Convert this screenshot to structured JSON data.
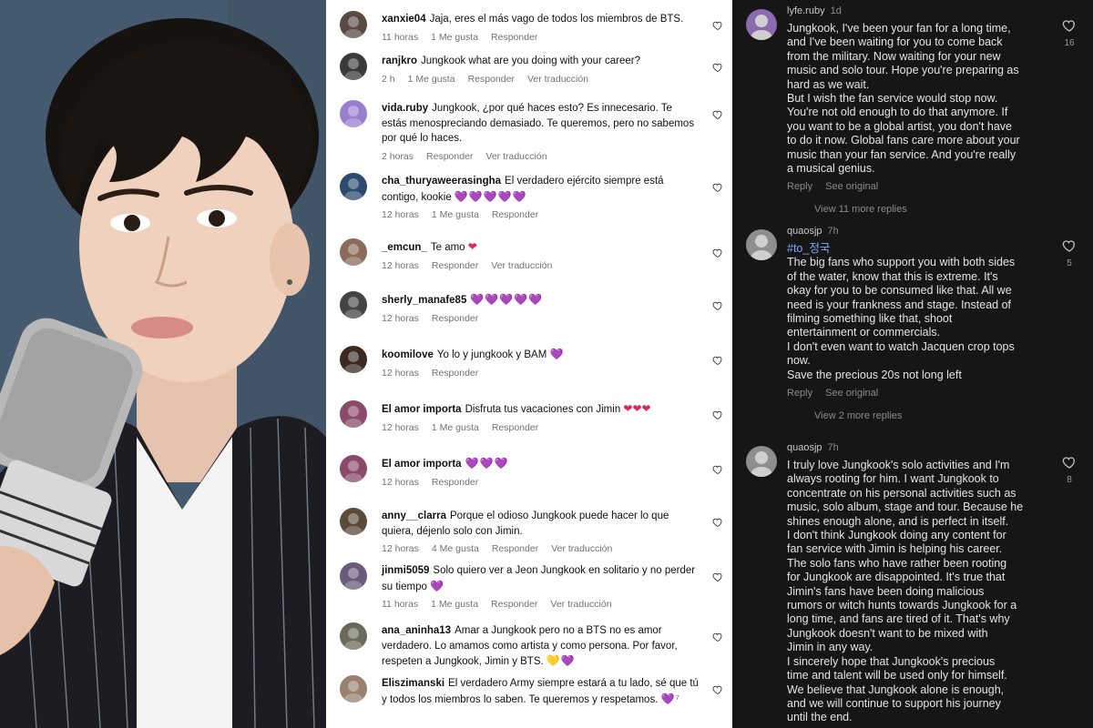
{
  "light_comments": [
    {
      "user": "xanxie04",
      "text": "Jaja, eres el más vago de todos los miembros de BTS.",
      "hearts": "",
      "time": "11 horas",
      "likes": "1 Me gusta",
      "reply": "Responder",
      "translate": "",
      "avatar_color": "#5a4a44"
    },
    {
      "user": "ranjkro",
      "text": "Jungkook what are you doing with your career?",
      "hearts": "",
      "time": "2 h",
      "likes": "1 Me gusta",
      "reply": "Responder",
      "translate": "Ver traducción",
      "avatar_color": "#3a3a3a"
    },
    {
      "user": "vida.ruby",
      "text": "Jungkook, ¿por qué haces esto? Es innecesario. Te estás menospreciando demasiado. Te queremos, pero no sabemos por qué lo haces.",
      "hearts": "",
      "time": "2 horas",
      "likes": "",
      "reply": "Responder",
      "translate": "Ver traducción",
      "avatar_color": "#9a7fd0"
    },
    {
      "user": "cha_thuryaweerasingha",
      "text": "El verdadero ejército siempre está contigo, kookie",
      "hearts": "💜💜💜💜💜",
      "time": "12 horas",
      "likes": "1 Me gusta",
      "reply": "Responder",
      "translate": "",
      "avatar_color": "#2c4a6e"
    },
    {
      "user": "_emcun_",
      "text": "Te amo",
      "hearts": "❤",
      "time": "12 horas",
      "likes": "",
      "reply": "Responder",
      "translate": "Ver traducción",
      "avatar_color": "#8a6a5a"
    },
    {
      "user": "sherly_manafe85",
      "text": "",
      "hearts": "💜💜💜💜💜",
      "time": "12 horas",
      "likes": "",
      "reply": "Responder",
      "translate": "",
      "avatar_color": "#444"
    },
    {
      "user": "koomilove",
      "text": "Yo lo y jungkook y BAM",
      "hearts": "💜",
      "time": "12 horas",
      "likes": "",
      "reply": "Responder",
      "translate": "",
      "avatar_color": "#3b2a22"
    },
    {
      "user": "El amor importa",
      "text": "Disfruta tus vacaciones con Jimin",
      "hearts": "❤❤❤",
      "time": "12 horas",
      "likes": "1 Me gusta",
      "reply": "Responder",
      "translate": "",
      "avatar_color": "#8a4a6a"
    },
    {
      "user": "El amor importa",
      "text": "",
      "hearts": "💜💜💜",
      "time": "12 horas",
      "likes": "",
      "reply": "Responder",
      "translate": "",
      "avatar_color": "#8a4a6a"
    },
    {
      "user": "anny__clarra",
      "text": "Porque el odioso Jungkook puede hacer lo que quiera, déjenlo solo con Jimin.",
      "hearts": "",
      "time": "12 horas",
      "likes": "4 Me gusta",
      "reply": "Responder",
      "translate": "Ver traducción",
      "avatar_color": "#5a4a3a"
    },
    {
      "user": "jinmi5059",
      "text": "Solo quiero ver a Jeon Jungkook en solitario y no perder su tiempo",
      "hearts": "💜",
      "time": "11 horas",
      "likes": "1 Me gusta",
      "reply": "Responder",
      "translate": "Ver traducción",
      "avatar_color": "#6a5a7a"
    },
    {
      "user": "ana_aninha13",
      "text": "Amar a Jungkook pero no a BTS no es amor verdadero. Lo amamos como artista y como persona. Por favor, respeten a Jungkook, Jimin y BTS.",
      "hearts": "💛💜",
      "time": "",
      "likes": "",
      "reply": "",
      "translate": "",
      "avatar_color": "#6a6a5a"
    },
    {
      "user": "Eliszimanski",
      "text": "El verdadero Army siempre estará a tu lado, sé que tú y todos los miembros lo saben. Te queremos y respetamos.",
      "hearts": "💜⁷",
      "time": "",
      "likes": "",
      "reply": "",
      "translate": "",
      "avatar_color": "#9a8070"
    }
  ],
  "dark_comments": [
    {
      "user": "lyfe.ruby",
      "time": "1d",
      "tag": "",
      "lines": [
        "Jungkook, I've been your fan for a long time,",
        "and I've been waiting for you to come back",
        "from the military. Now waiting for your new",
        "music and solo tour. Hope you're preparing as",
        "hard as we wait.",
        "But I wish the fan service would stop now.",
        "You're not old enough to do that anymore. If",
        "you want to be a global artist, you don't have",
        "to do it now. Global fans care more about your",
        "music than your fan service. And you're really",
        "a musical genius."
      ],
      "reply": "Reply",
      "see_original": "See original",
      "more": "View 11 more replies",
      "likes": "16",
      "avatar_color": "#8a6bb0"
    },
    {
      "user": "quaosjp",
      "time": "7h",
      "tag": "#to_정국",
      "lines": [
        "The big fans who support you with both sides",
        "of the water, know that this is extreme. It's",
        "okay for you to be consumed like that. All we",
        "need is your frankness and stage. Instead of",
        "filming something like that, shoot",
        "entertainment or commercials.",
        "I don't even want to watch Jacquen crop tops",
        "now.",
        "Save the precious 20s not long left"
      ],
      "reply": "Reply",
      "see_original": "See original",
      "more": "View 2 more replies",
      "likes": "5",
      "avatar_color": "#8e8e8e"
    },
    {
      "user": "quaosjp",
      "time": "7h",
      "tag": "",
      "lines": [
        "I truly love Jungkook's solo activities and I'm",
        "always rooting for him. I want Jungkook to",
        "concentrate on his personal activities such as",
        "music, solo album, stage and tour. Because he",
        "shines enough alone, and is perfect in itself.",
        "I don't think Jungkook doing any content for",
        "fan service with Jimin is helping his career.",
        "The solo fans who have rather been rooting",
        "for Jungkook are disappointed. It's true that",
        "Jimin's fans have been doing malicious",
        "rumors or witch hunts towards Jungkook for a",
        "long time, and fans are tired of it. That's why",
        "Jungkook doesn't want to be mixed with",
        "Jimin in any way.",
        "I sincerely hope that Jungkook's precious",
        "time and talent will be used only for himself.",
        "We believe that Jungkook alone is enough,",
        "and we will continue to support his journey",
        "until the end."
      ],
      "reply": "",
      "see_original": "",
      "more": "",
      "likes": "8",
      "avatar_color": "#8e8e8e"
    }
  ]
}
